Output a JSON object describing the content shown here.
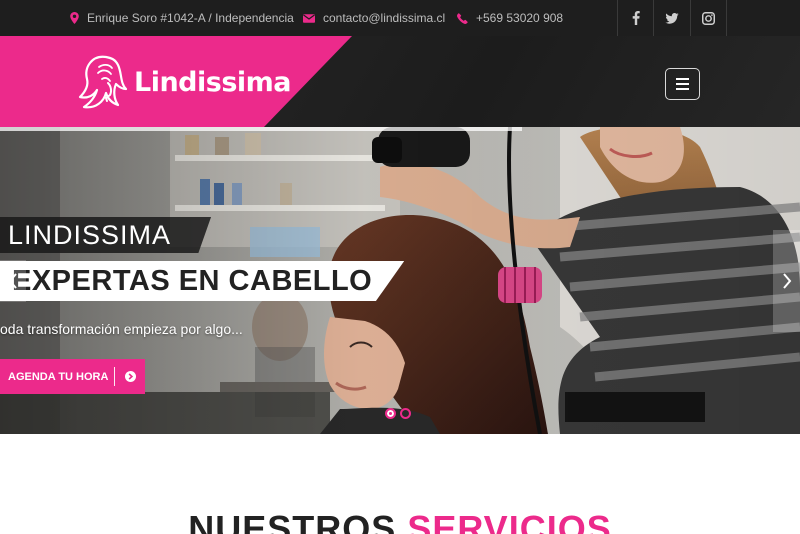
{
  "topbar": {
    "address": "Enrique Soro #1042-A / Independencia",
    "email": "contacto@lindissima.cl",
    "phone": "+569 53020 908",
    "icons": [
      "map-marker-icon",
      "envelope-icon",
      "phone-icon"
    ],
    "social": [
      "facebook-icon",
      "twitter-icon",
      "instagram-icon"
    ]
  },
  "header": {
    "logo_text": "Lindissima",
    "menu_icon": "hamburger-icon"
  },
  "hero": {
    "caption_title": "LINDISSIMA",
    "caption_subtitle": "EXPERTAS EN CABELLO",
    "caption_text": "oda transformación empieza por algo...",
    "cta_label": "AGENDA TU HORA",
    "slide_count": 2,
    "active_slide": 1
  },
  "services": {
    "title_part1": "NUESTROS",
    "title_part2": "SERVICIOS"
  },
  "colors": {
    "accent": "#ec2a8b",
    "topbar_bg": "#1e1e1e",
    "header_bg": "#222222"
  }
}
